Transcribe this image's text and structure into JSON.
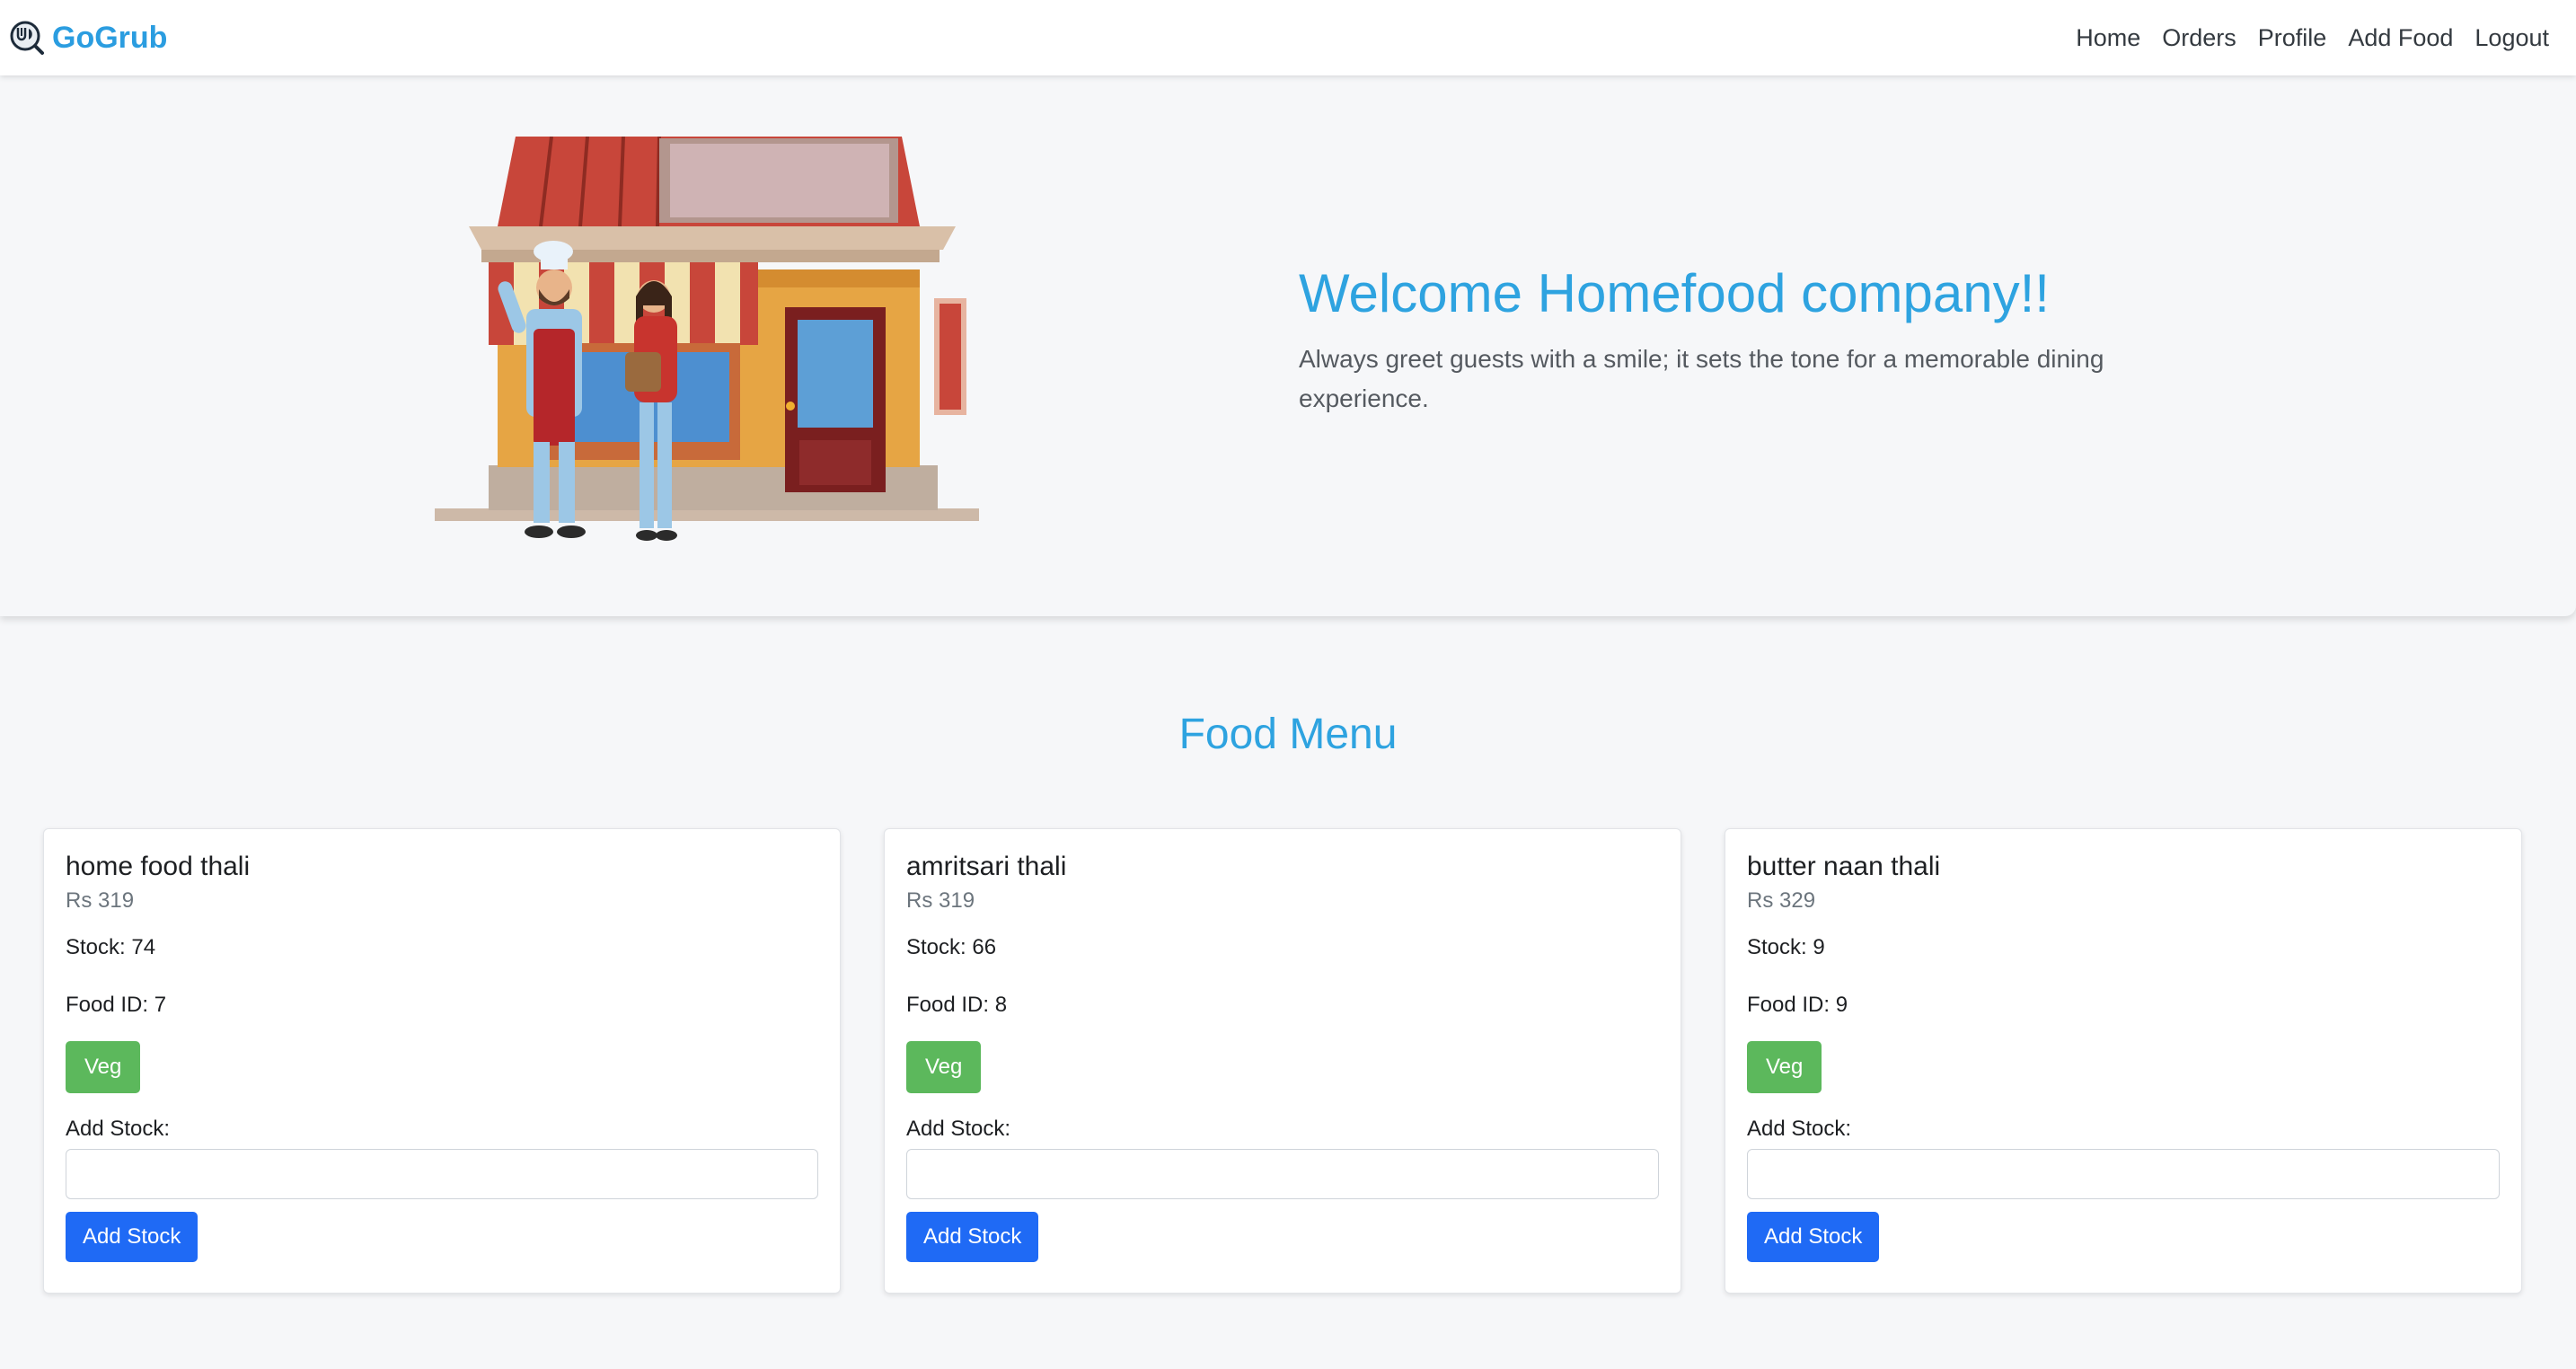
{
  "navbar": {
    "brand": "GoGrub",
    "brand_color": "#2b9de0",
    "links": [
      "Home",
      "Orders",
      "Profile",
      "Add Food",
      "Logout"
    ]
  },
  "hero": {
    "title": "Welcome Homefood company!!",
    "subtitle": "Always greet guests with a smile; it sets the tone for a memorable dining experience.",
    "illustration_icon": "storefront-with-chef-and-customer"
  },
  "menu": {
    "title": "Food Menu",
    "items": [
      {
        "name": "home food thali",
        "price": "Rs 319",
        "stock": "Stock: 74",
        "food_id": "Food ID: 7",
        "type": "Veg",
        "add_stock_label": "Add Stock:",
        "stock_value": "",
        "button": "Add Stock"
      },
      {
        "name": "amritsari thali",
        "price": "Rs 319",
        "stock": "Stock: 66",
        "food_id": "Food ID: 8",
        "type": "Veg",
        "add_stock_label": "Add Stock:",
        "stock_value": "",
        "button": "Add Stock"
      },
      {
        "name": "butter naan thali",
        "price": "Rs 329",
        "stock": "Stock: 9",
        "food_id": "Food ID: 9",
        "type": "Veg",
        "add_stock_label": "Add Stock:",
        "stock_value": "",
        "button": "Add Stock"
      }
    ]
  },
  "colors": {
    "accent": "#2ea3e0",
    "veg_badge": "#5cb85c",
    "primary_button": "#1f6af5"
  }
}
